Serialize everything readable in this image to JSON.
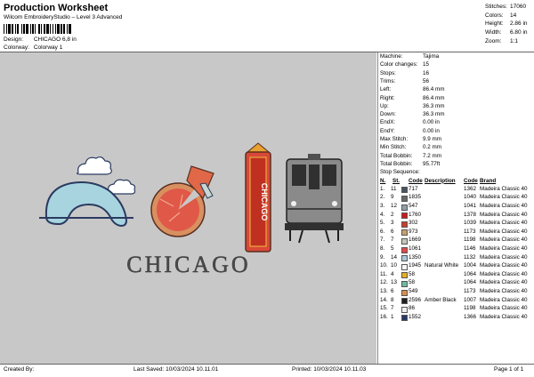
{
  "header": {
    "title": "Production Worksheet",
    "subtitle": "Wilcom EmbroideryStudio – Level 3 Advanced",
    "design_label": "Design:",
    "design_value": "CHICAGO 6,8 in",
    "colorway_label": "Colorway:",
    "colorway_value": "Colorway 1"
  },
  "stats": [
    {
      "label": "Stitches:",
      "value": "17060"
    },
    {
      "label": "Colors:",
      "value": "14"
    },
    {
      "label": "Height:",
      "value": "2.86 in"
    },
    {
      "label": "Width:",
      "value": "6.80 in"
    },
    {
      "label": "Zoom:",
      "value": "1:1"
    }
  ],
  "canvas": {
    "design_text": "CHICAGO",
    "sign_text": "CHICAGO",
    "background": "#c8c8c8"
  },
  "info": [
    {
      "label": "Machine:",
      "value": "Tajima"
    },
    {
      "label": "Color changes:",
      "value": "15"
    },
    {
      "label": "Stops:",
      "value": "16"
    },
    {
      "label": "Trims:",
      "value": "56"
    },
    {
      "label": "Left:",
      "value": "86.4 mm"
    },
    {
      "label": "Right:",
      "value": "86.4 mm"
    },
    {
      "label": "Up:",
      "value": "36.3 mm"
    },
    {
      "label": "Down:",
      "value": "36.3 mm"
    },
    {
      "label": "EndX:",
      "value": "0.00 in"
    },
    {
      "label": "EndY:",
      "value": "0.00 in"
    },
    {
      "label": "Max Stitch:",
      "value": "9.9 mm"
    },
    {
      "label": "Min Stitch:",
      "value": "0.2 mm"
    },
    {
      "label": "Total Bobbin:",
      "value": "7.2 mm"
    },
    {
      "label": "Total Bobbin:",
      "value": "95.77ft"
    }
  ],
  "sequence": {
    "heading": "Stop Sequence:",
    "columns": {
      "n": "N.",
      "st": "St.",
      "code_col": "Code",
      "desc": "Description",
      "code": "Code",
      "brand": "Brand"
    },
    "rows": [
      {
        "n": "1.",
        "st": "11",
        "color": "#4a5560",
        "code": "717",
        "desc": "",
        "stitches": "1362",
        "brand": "Madeira Classic 40"
      },
      {
        "n": "2.",
        "st": "9",
        "color": "#6a6a6a",
        "code": "1835",
        "desc": "",
        "stitches": "1040",
        "brand": "Madeira Classic 40"
      },
      {
        "n": "3.",
        "st": "12",
        "color": "#90a0a8",
        "code": "547",
        "desc": "",
        "stitches": "1041",
        "brand": "Madeira Classic 40"
      },
      {
        "n": "4.",
        "st": "2",
        "color": "#d01818",
        "code": "1760",
        "desc": "",
        "stitches": "1378",
        "brand": "Madeira Classic 40"
      },
      {
        "n": "5.",
        "st": "3",
        "color": "#c84030",
        "code": "302",
        "desc": "",
        "stitches": "1039",
        "brand": "Madeira Classic 40"
      },
      {
        "n": "6.",
        "st": "6",
        "color": "#c8a070",
        "code": "973",
        "desc": "",
        "stitches": "1173",
        "brand": "Madeira Classic 40"
      },
      {
        "n": "7.",
        "st": "7",
        "color": "#c0c8b8",
        "code": "1669",
        "desc": "",
        "stitches": "1198",
        "brand": "Madeira Classic 40"
      },
      {
        "n": "8.",
        "st": "5",
        "color": "#e04848",
        "code": "1061",
        "desc": "",
        "stitches": "1146",
        "brand": "Madeira Classic 40"
      },
      {
        "n": "9.",
        "st": "14",
        "color": "#a8c8d8",
        "code": "1350",
        "desc": "",
        "stitches": "1132",
        "brand": "Madeira Classic 40"
      },
      {
        "n": "10.",
        "st": "10",
        "color": "#f4f4f4",
        "code": "1945",
        "desc": "Natural White",
        "stitches": "1004",
        "brand": "Madeira Classic 40"
      },
      {
        "n": "11.",
        "st": "4",
        "color": "#e8b020",
        "code": "58",
        "desc": "",
        "stitches": "1064",
        "brand": "Madeira Classic 40"
      },
      {
        "n": "12.",
        "st": "13",
        "color": "#70b8a0",
        "code": "58",
        "desc": "",
        "stitches": "1064",
        "brand": "Madeira Classic 40"
      },
      {
        "n": "13.",
        "st": "6",
        "color": "#d89050",
        "code": "549",
        "desc": "",
        "stitches": "1173",
        "brand": "Madeira Classic 40"
      },
      {
        "n": "14.",
        "st": "8",
        "color": "#202020",
        "code": "2596",
        "desc": "Amber Black",
        "stitches": "1007",
        "brand": "Madeira Classic 40"
      },
      {
        "n": "15.",
        "st": "7",
        "color": "#f0f0f0",
        "code": "86",
        "desc": "",
        "stitches": "1198",
        "brand": "Madeira Classic 40"
      },
      {
        "n": "16.",
        "st": "1",
        "color": "#283868",
        "code": "1552",
        "desc": "",
        "stitches": "1366",
        "brand": "Madeira Classic 40"
      }
    ]
  },
  "footer": {
    "created": "Created By:",
    "saved": "Last Saved: 10/03/2024 10.11.01",
    "printed": "Printed: 10/03/2024 10.11.03",
    "page": "Page 1 of 1"
  }
}
